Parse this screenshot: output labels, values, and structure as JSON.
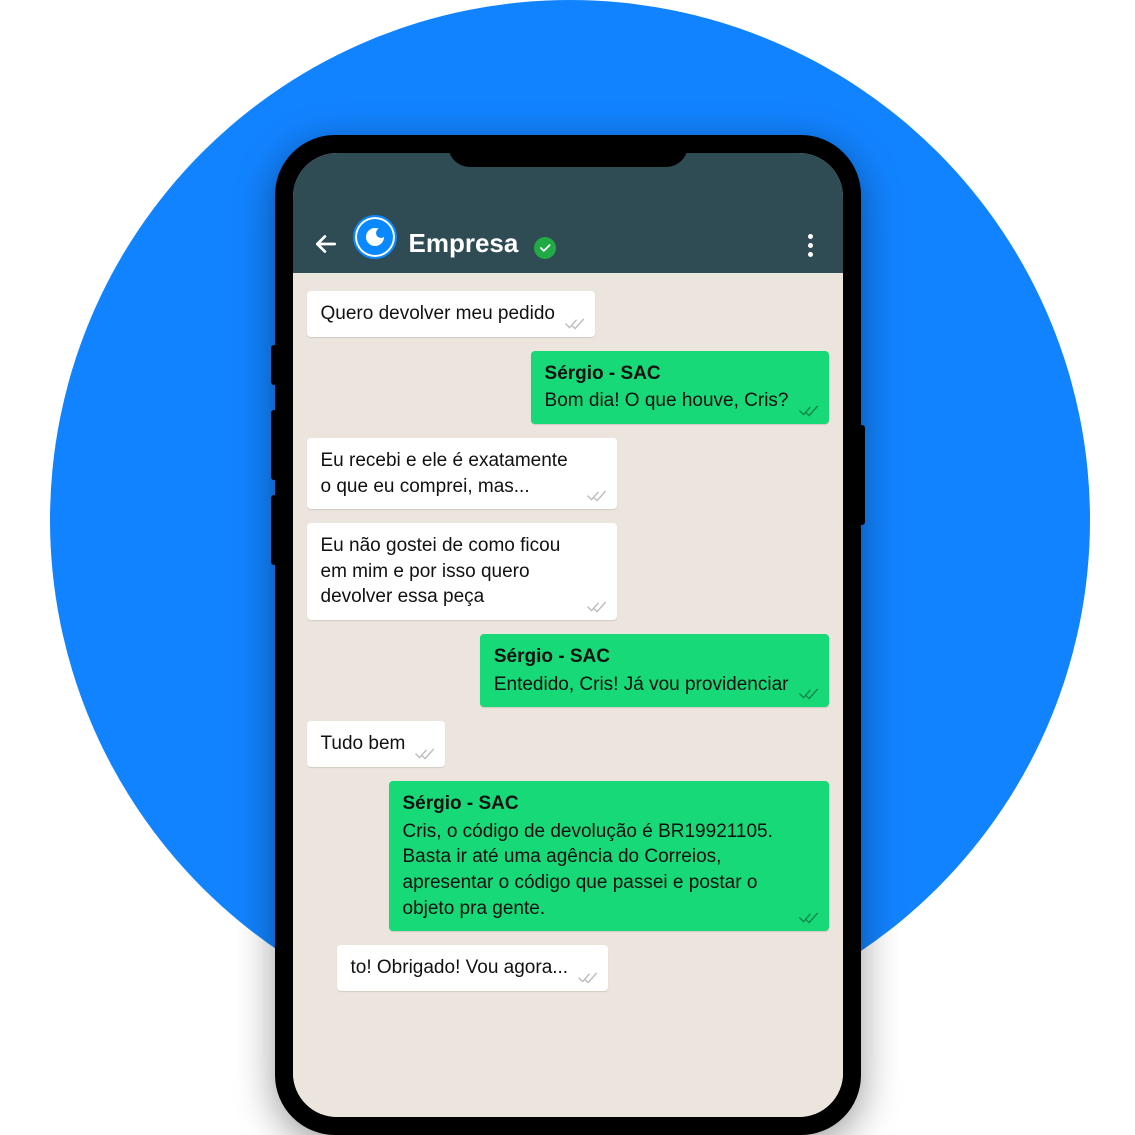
{
  "header": {
    "contact_name": "Empresa"
  },
  "messages": [
    {
      "side": "incoming",
      "sender": "",
      "text": "Quero devolver meu pedido"
    },
    {
      "side": "outgoing",
      "sender": "Sérgio - SAC",
      "text": "Bom dia! O que houve, Cris?"
    },
    {
      "side": "incoming",
      "sender": "",
      "text": "Eu recebi e ele é exatamente o que eu comprei, mas..."
    },
    {
      "side": "incoming",
      "sender": "",
      "text": "Eu não gostei de como ficou em mim e por isso quero devolver essa peça"
    },
    {
      "side": "outgoing",
      "sender": "Sérgio - SAC",
      "text": "Entedido, Cris! Já vou providenciar"
    },
    {
      "side": "incoming",
      "sender": "",
      "text": "Tudo bem"
    },
    {
      "side": "outgoing",
      "sender": "Sérgio - SAC",
      "text": "Cris, o código de devolução é BR19921105. Basta ir até uma agência do Correios, apresentar o código que passei e postar o objeto pra gente."
    },
    {
      "side": "incoming",
      "sender": "",
      "text": "to! Obrigado! Vou agora..."
    }
  ],
  "colors": {
    "bg_circle": "#1283ff",
    "header_bg": "#2f4b53",
    "chat_bg": "#ece5dd",
    "outgoing_bubble": "#17d977",
    "incoming_bubble": "#ffffff"
  }
}
